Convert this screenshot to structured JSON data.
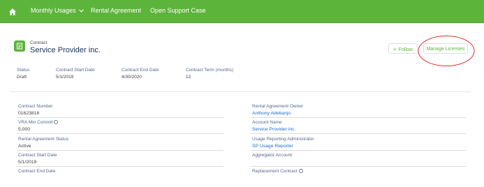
{
  "nav": {
    "home_icon": "home-icon",
    "items": [
      "Monthly Usages",
      "Rental Agreement",
      "Open Support Case"
    ],
    "chevron": "chevron-down-icon"
  },
  "record": {
    "object_label": "Contract",
    "title": "Service Provider inc.",
    "icon": "contract-icon"
  },
  "actions": {
    "follow_label": "Follow",
    "manage_label": "Manage Licenses"
  },
  "highlights": [
    {
      "label": "Status",
      "value": "Draft"
    },
    {
      "label": "Contract Start Date",
      "value": "5/1/2019"
    },
    {
      "label": "Contract End Date",
      "value": "4/30/2020"
    },
    {
      "label": "Contract Term (months)",
      "value": "12"
    }
  ],
  "details": {
    "left": [
      {
        "label": "Contract Number",
        "value": "01623816"
      },
      {
        "label": "VRA Min Commit",
        "value": "5,000"
      },
      {
        "label": "Rental Agreement Status",
        "value": "Active"
      },
      {
        "label": "Contract Start Date",
        "value": "5/1/2019"
      },
      {
        "label": "Contract End Date",
        "value": ""
      }
    ],
    "right": [
      {
        "label": "Rental Agreement Owner",
        "value": "Anthony Adebanjo"
      },
      {
        "label": "Account Name",
        "value": "Service Provider inc."
      },
      {
        "label": "Usage Reporting Administrator",
        "value": "SP Usage Reporter"
      },
      {
        "label": "Aggregator Account",
        "value": ""
      },
      {
        "label": "Replacement Contract",
        "value": ""
      }
    ]
  },
  "colors": {
    "brand_green": "#5db43b",
    "link_blue": "#1a6ad6",
    "annotation_red": "#e0312b"
  }
}
